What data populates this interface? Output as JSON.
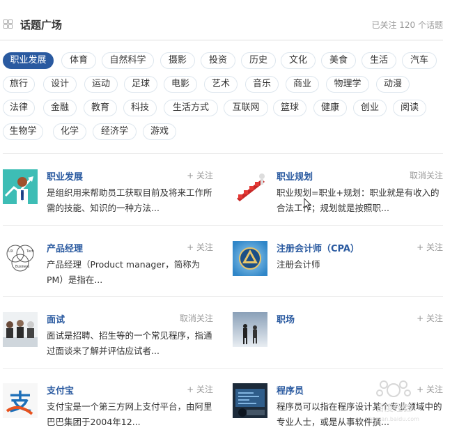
{
  "header": {
    "title": "话题广场",
    "count": "已关注 120 个话题"
  },
  "tags": [
    [
      "职业发展",
      "体育",
      "自然科学",
      "摄影",
      "投资",
      "历史",
      "文化",
      "美食",
      "生活",
      "汽车"
    ],
    [
      "旅行",
      "设计",
      "运动",
      "足球",
      "电影",
      "艺术",
      "音乐",
      "商业",
      "物理学",
      "动漫"
    ],
    [
      "法律",
      "金融",
      "教育",
      "科技",
      "生活方式",
      "互联网",
      "篮球",
      "健康",
      "创业",
      "阅读"
    ],
    [
      "生物学",
      "化学",
      "经济学",
      "游戏"
    ]
  ],
  "active_tag": "职业发展",
  "topics": [
    {
      "name": "职业发展",
      "follow": "+ 关注",
      "desc": "是组织用来帮助员工获取目前及将来工作所需的技能、知识的一种方法...",
      "icon": "career-thumb"
    },
    {
      "name": "职业规划",
      "follow": "取消关注",
      "desc": "职业规划=职业+规划：职业就是有收入的合法工作；规划就是按照职...",
      "icon": "planning-thumb"
    },
    {
      "name": "产品经理",
      "follow": "+ 关注",
      "desc": "产品经理（Product manager，简称为PM）是指在...",
      "icon": "venn-thumb"
    },
    {
      "name": "注册会计师（CPA）",
      "follow": "+ 关注",
      "desc": "注册会计师",
      "icon": "cpa-emblem-thumb"
    },
    {
      "name": "面试",
      "follow": "取消关注",
      "desc": "面试是招聘、招生等的一个常见程序，指通过面谈来了解并评估应试者...",
      "icon": "interview-thumb"
    },
    {
      "name": "职场",
      "follow": "+ 关注",
      "desc": "",
      "icon": "workplace-thumb"
    },
    {
      "name": "支付宝",
      "follow": "+ 关注",
      "desc": "支付宝是一个第三方网上支付平台，由阿里巴巴集团于2004年12...",
      "icon": "alipay-thumb"
    },
    {
      "name": "程序员",
      "follow": "+ 关注",
      "desc": "程序员可以指在程序设计某个专业领域中的专业人士，或是从事软件撰...",
      "icon": "programmer-thumb"
    }
  ],
  "watermark": {
    "text": "百度经验",
    "url_text": "jingyan.baidu.com"
  }
}
